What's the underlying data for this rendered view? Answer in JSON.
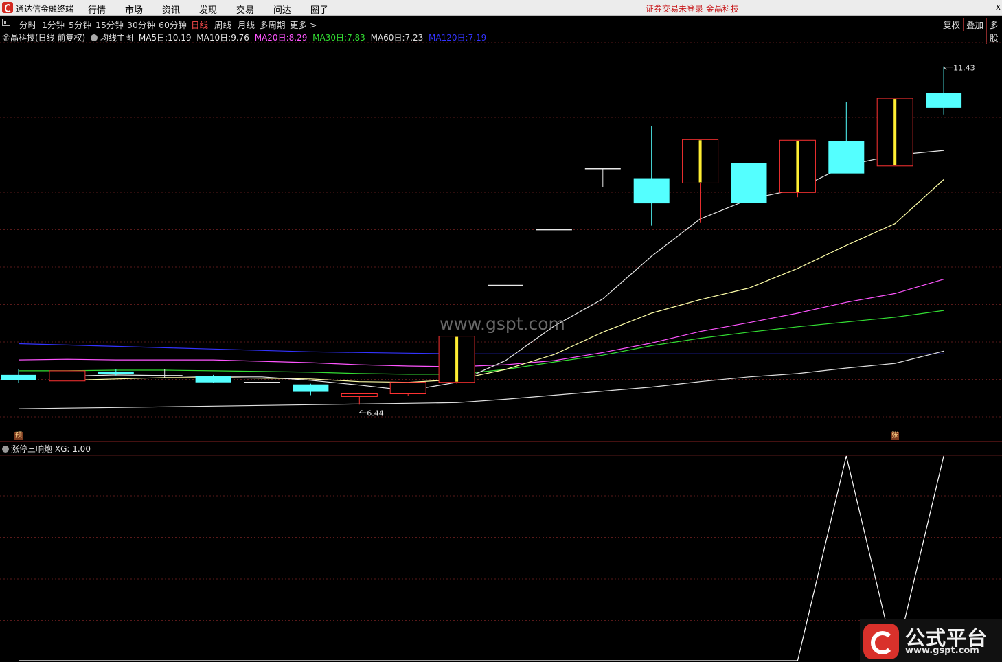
{
  "app": {
    "title": "通达信金融终端",
    "logo_icon": "tdx-logo-icon"
  },
  "menu": [
    "行情",
    "市场",
    "资讯",
    "发现",
    "交易",
    "问达",
    "圈子"
  ],
  "notice": "证券交易未登录  金晶科技",
  "close_glyph": "x",
  "periods": [
    "分时",
    "1分钟",
    "5分钟",
    "15分钟",
    "30分钟",
    "60分钟",
    "日线",
    "周线",
    "月线",
    "多周期",
    "更多 >"
  ],
  "active_period": "日线",
  "right_buttons": [
    "复权",
    "叠加",
    "多股"
  ],
  "legend": {
    "stock": "金晶科技(日线 前复权)",
    "indicator": "均线主图",
    "items": [
      {
        "label": "MA5日:",
        "value": "10.19",
        "color": "#e8e8e8"
      },
      {
        "label": "MA10日:",
        "value": "9.76",
        "color": "#ffffa8"
      },
      {
        "label": "MA20日:",
        "value": "8.29",
        "color": "#ff55ff"
      },
      {
        "label": "MA30日:",
        "value": "7.83",
        "color": "#33dd33"
      },
      {
        "label": "MA60日:",
        "value": "7.23",
        "color": "#e0e0e0"
      },
      {
        "label": "MA120日:",
        "value": "7.19",
        "color": "#3333ff"
      }
    ]
  },
  "watermark": "www.gspt.com",
  "tags": {
    "left": "预",
    "right": "张"
  },
  "sub_legend": {
    "name": "涨停三响炮",
    "label": "XG:",
    "value": "1.00"
  },
  "brand": {
    "name": "公式平台",
    "url": "www.gspt.com"
  },
  "chart_data": {
    "type": "candlestick",
    "y_range": [
      6.2,
      11.7
    ],
    "high_label": "11.43",
    "low_label": "6.44",
    "colors": {
      "up": "#ff3232",
      "down": "#54ffff",
      "limit_up_bar": "#ffee33",
      "ma5": "#e8e8e8",
      "ma10": "#ffffa8",
      "ma20": "#ff55ff",
      "ma30": "#33dd33",
      "ma60": "#e0e0e0",
      "ma120": "#3333ff",
      "xg": "#ffffff"
    },
    "candles": [
      {
        "o": 6.88,
        "h": 6.97,
        "l": 6.76,
        "c": 6.8
      },
      {
        "o": 6.79,
        "h": 6.94,
        "l": 6.79,
        "c": 6.94
      },
      {
        "o": 6.93,
        "h": 6.97,
        "l": 6.87,
        "c": 6.89
      },
      {
        "o": 6.88,
        "h": 6.96,
        "l": 6.84,
        "c": 6.87
      },
      {
        "o": 6.86,
        "h": 6.88,
        "l": 6.76,
        "c": 6.77
      },
      {
        "o": 6.76,
        "h": 6.79,
        "l": 6.71,
        "c": 6.77
      },
      {
        "o": 6.74,
        "h": 6.75,
        "l": 6.58,
        "c": 6.63
      },
      {
        "o": 6.56,
        "h": 6.61,
        "l": 6.44,
        "c": 6.6
      },
      {
        "o": 6.6,
        "h": 6.77,
        "l": 6.57,
        "c": 6.77
      },
      {
        "o": 6.77,
        "h": 7.45,
        "l": 6.75,
        "c": 7.45
      },
      {
        "o": 8.2,
        "h": 8.2,
        "l": 8.2,
        "c": 8.2
      },
      {
        "o": 9.02,
        "h": 9.02,
        "l": 9.02,
        "c": 9.02
      },
      {
        "o": 9.92,
        "h": 9.92,
        "l": 9.65,
        "c": 9.92
      },
      {
        "o": 9.78,
        "h": 10.55,
        "l": 9.08,
        "c": 9.41
      },
      {
        "o": 9.71,
        "h": 10.35,
        "l": 9.12,
        "c": 10.35
      },
      {
        "o": 10.0,
        "h": 10.13,
        "l": 9.37,
        "c": 9.42
      },
      {
        "o": 9.57,
        "h": 10.34,
        "l": 9.5,
        "c": 10.34
      },
      {
        "o": 10.33,
        "h": 10.91,
        "l": 9.98,
        "c": 9.85
      },
      {
        "o": 9.96,
        "h": 10.96,
        "l": 9.96,
        "c": 10.96
      },
      {
        "o": 11.04,
        "h": 11.43,
        "l": 10.72,
        "c": 10.82
      }
    ],
    "ma": {
      "ma5": [
        null,
        6.86,
        6.88,
        6.87,
        6.85,
        6.85,
        6.8,
        6.73,
        6.65,
        6.77,
        7.09,
        7.6,
        8.0,
        8.63,
        9.18,
        9.47,
        9.62,
        9.97,
        10.12,
        10.19
      ],
      "ma10": [
        null,
        6.8,
        6.82,
        6.84,
        6.84,
        6.83,
        6.82,
        6.78,
        6.77,
        6.81,
        6.96,
        7.18,
        7.51,
        7.79,
        7.99,
        8.16,
        8.45,
        8.79,
        9.11,
        9.76
      ],
      "ma20": [
        7.1,
        7.11,
        7.1,
        7.1,
        7.1,
        7.08,
        7.06,
        7.03,
        7.01,
        7.0,
        7.03,
        7.09,
        7.21,
        7.35,
        7.52,
        7.65,
        7.79,
        7.95,
        8.08,
        8.29
      ],
      "ma30": [
        6.94,
        6.94,
        6.95,
        6.95,
        6.94,
        6.93,
        6.92,
        6.9,
        6.89,
        6.89,
        6.96,
        7.07,
        7.17,
        7.31,
        7.42,
        7.51,
        7.59,
        7.66,
        7.73,
        7.83
      ],
      "ma60": [
        6.38,
        6.39,
        6.4,
        6.41,
        6.42,
        6.43,
        6.44,
        6.45,
        6.46,
        6.47,
        6.52,
        6.58,
        6.64,
        6.7,
        6.78,
        6.85,
        6.9,
        6.98,
        7.05,
        7.23
      ],
      "ma120": [
        7.34,
        7.32,
        7.3,
        7.28,
        7.26,
        7.24,
        7.22,
        7.21,
        7.2,
        7.19,
        7.19,
        7.19,
        7.19,
        7.19,
        7.19,
        7.19,
        7.19,
        7.19,
        7.19,
        7.19
      ]
    },
    "xg": [
      0,
      0,
      0,
      0,
      0,
      0,
      0,
      0,
      0,
      0,
      0,
      0,
      0,
      0,
      0,
      0,
      0,
      1,
      0,
      1
    ]
  }
}
